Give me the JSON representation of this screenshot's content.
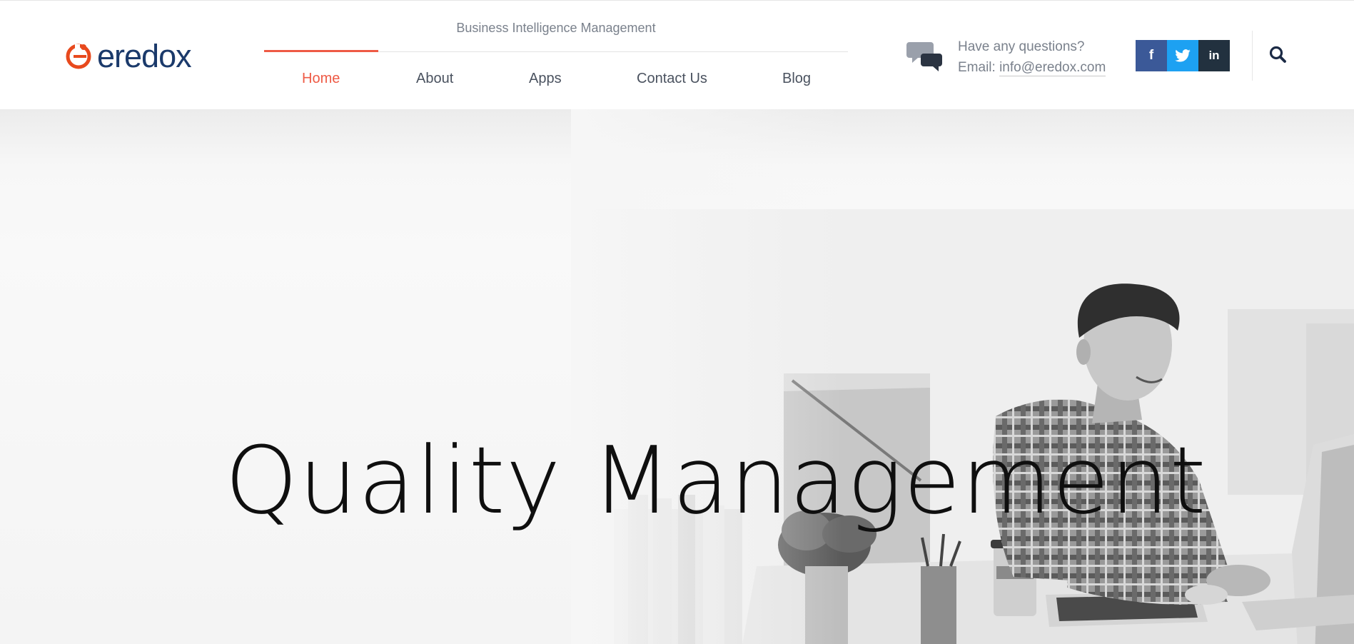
{
  "brand": {
    "logo_text": "eredox",
    "logo_icon": "eredox-logo-icon",
    "colors": {
      "primary": "#1b3a6b",
      "accent": "#ee5a45"
    }
  },
  "header": {
    "tagline": "Business Intelligence Management",
    "nav": [
      {
        "label": "Home",
        "active": true
      },
      {
        "label": "About",
        "active": false
      },
      {
        "label": "Apps",
        "active": false
      },
      {
        "label": "Contact Us",
        "active": false
      },
      {
        "label": "Blog",
        "active": false
      }
    ],
    "contact": {
      "icon": "chat-bubbles-icon",
      "question": "Have any questions?",
      "email_label": "Email:",
      "email": "info@eredox.com"
    },
    "social": [
      {
        "name": "facebook",
        "glyph": "f",
        "color": "#3b5998"
      },
      {
        "name": "twitter",
        "glyph": "twitter-bird",
        "color": "#1da1f2"
      },
      {
        "name": "linkedin",
        "glyph": "in",
        "color": "#22313f"
      }
    ],
    "search_icon": "search-icon"
  },
  "hero": {
    "title": "Quality Management",
    "image": "man-working-at-computer-desk-photo"
  }
}
